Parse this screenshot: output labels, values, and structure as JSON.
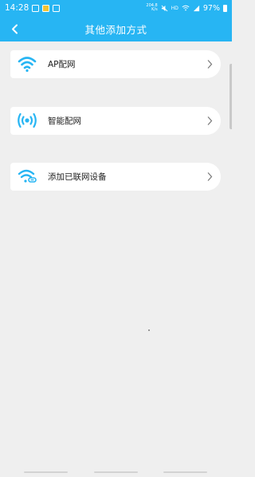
{
  "status_bar": {
    "time": "14:28",
    "net_speed_value": "204.8",
    "net_speed_unit": "K/s",
    "hd_label": "HD",
    "battery_percent": "97%"
  },
  "header": {
    "title": "其他添加方式"
  },
  "options": [
    {
      "label": "AP配网",
      "icon": "wifi-icon"
    },
    {
      "label": "智能配网",
      "icon": "broadcast-icon"
    },
    {
      "label": "添加已联网设备",
      "icon": "wifi-link-icon"
    }
  ],
  "colors": {
    "primary": "#27b5f3",
    "background": "#efefef",
    "card": "#ffffff"
  }
}
